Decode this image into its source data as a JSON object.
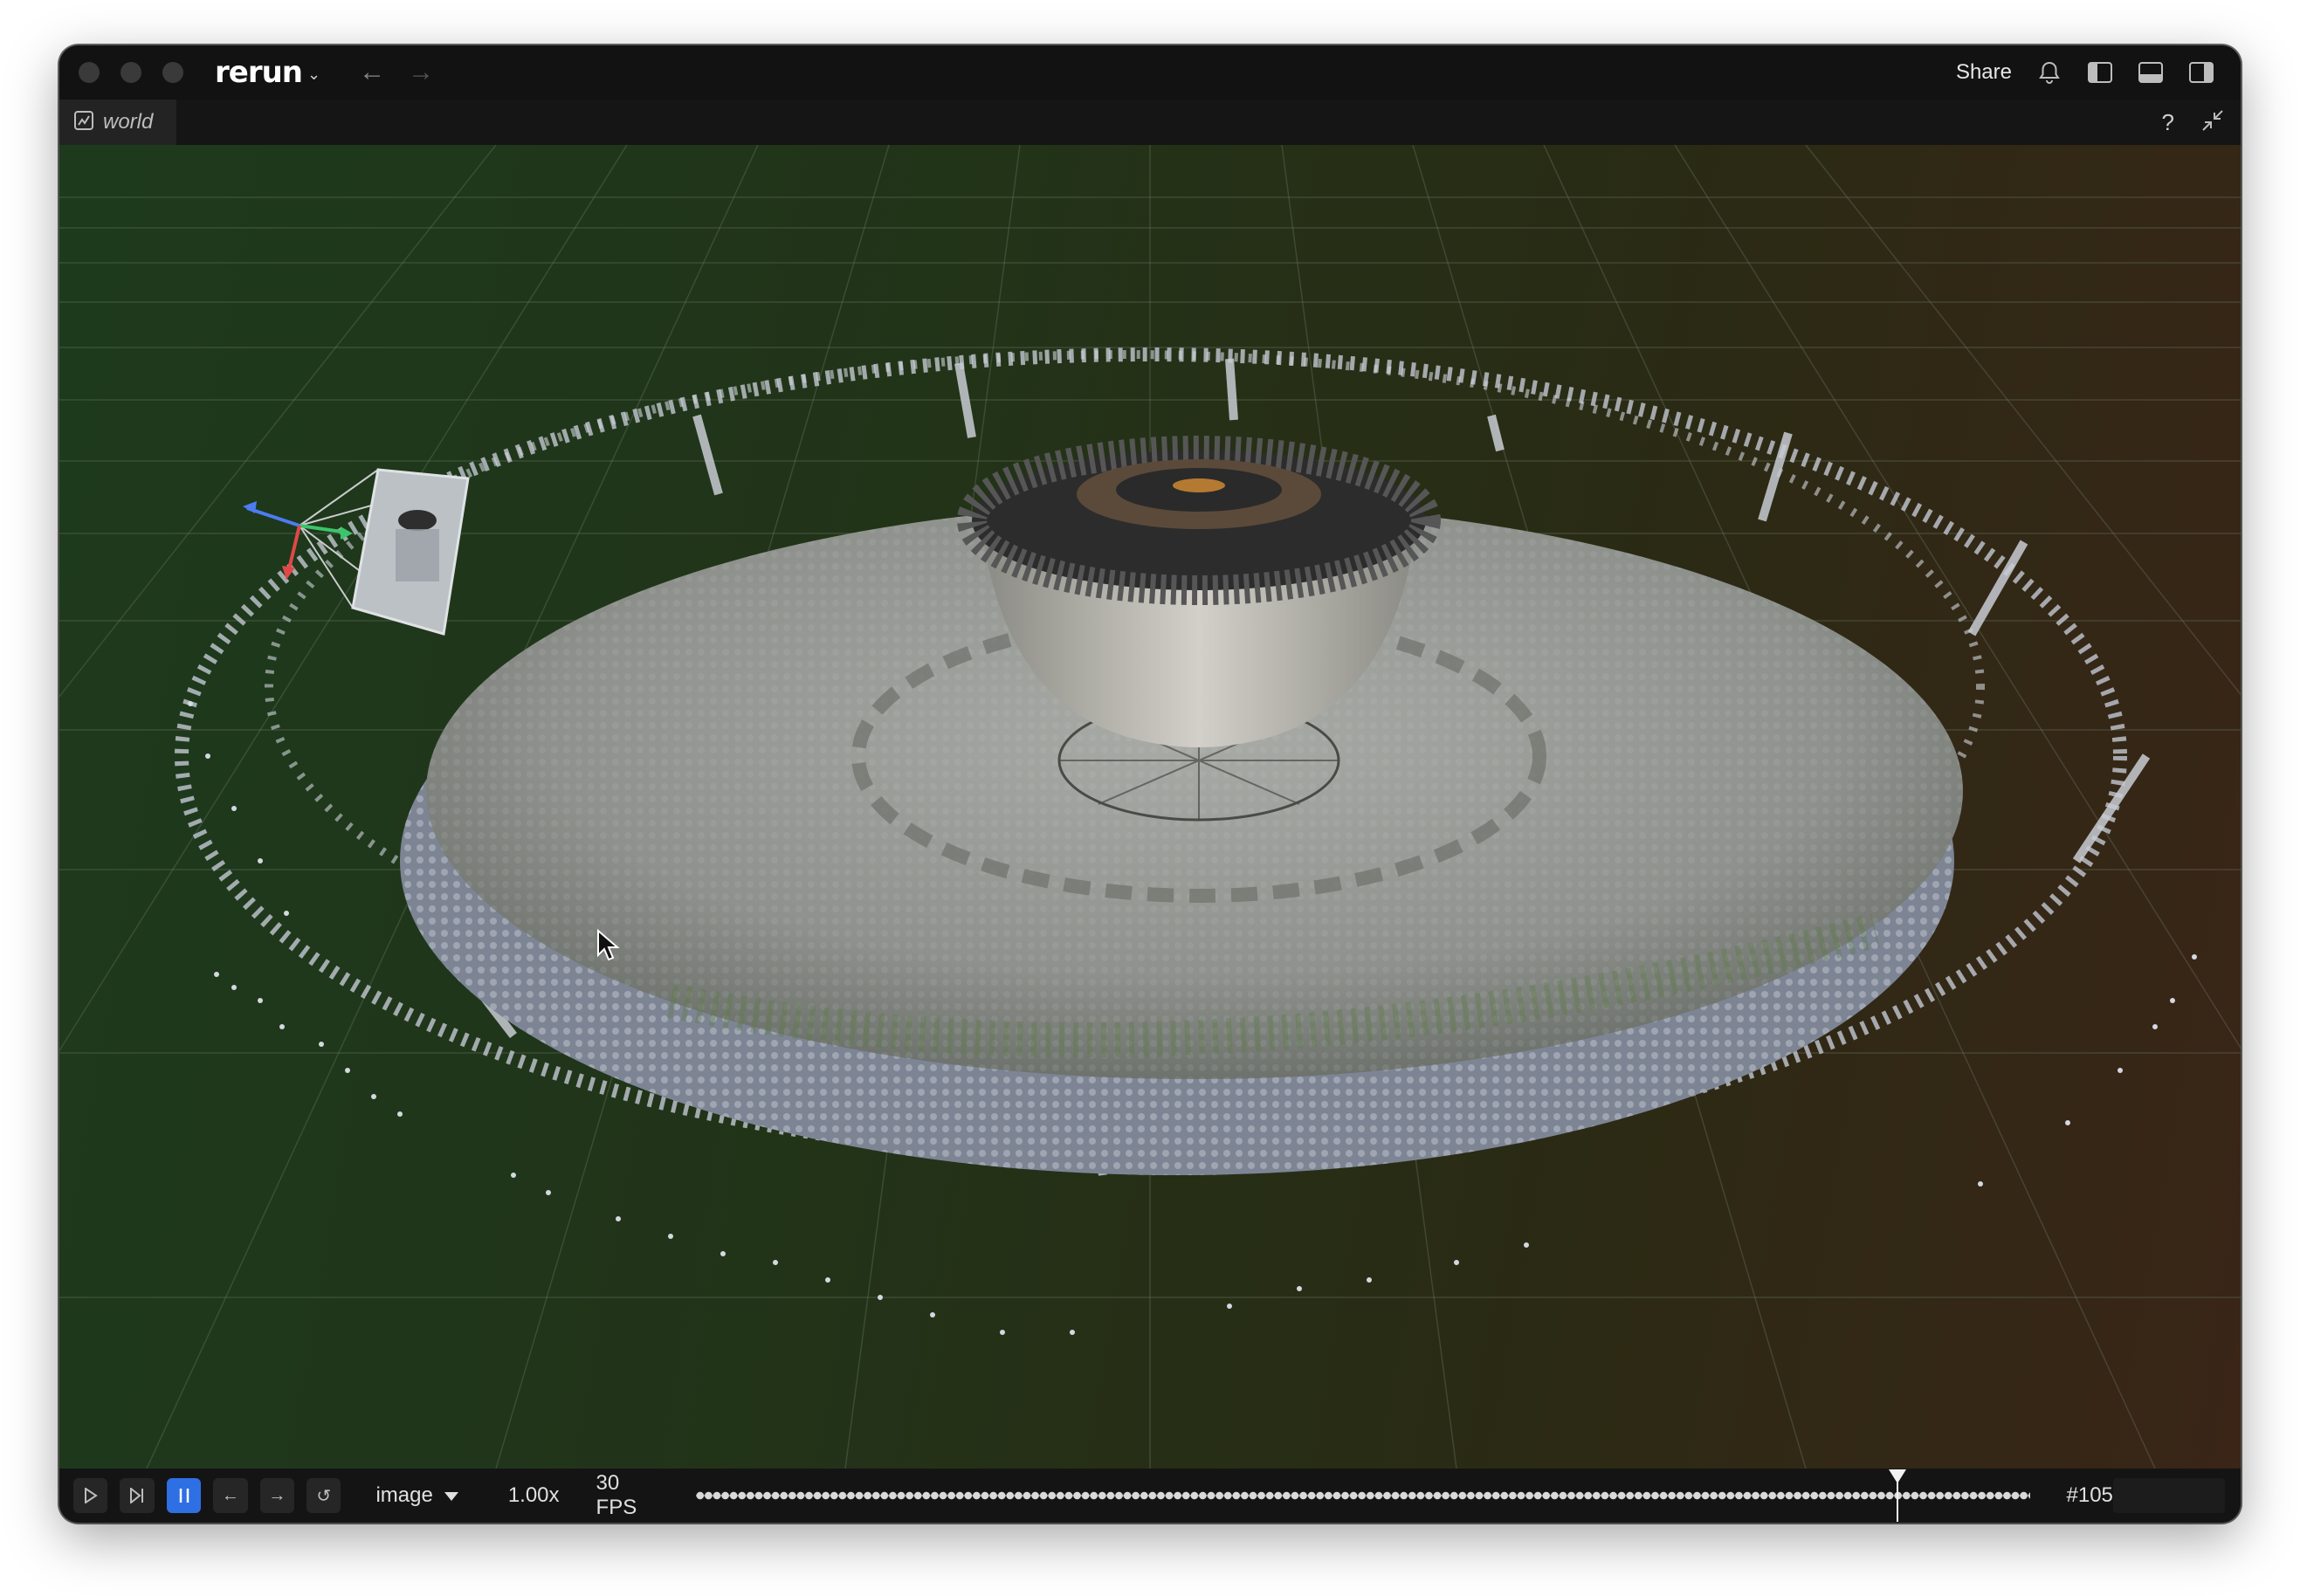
{
  "app": {
    "logo_text": "rerun",
    "share_label": "Share"
  },
  "tab": {
    "label": "world"
  },
  "toolbar": {
    "help_label": "?"
  },
  "timeline": {
    "name": "image",
    "speed": "1.00x",
    "fps": "30 FPS",
    "frame": "#105",
    "playhead_fraction": 0.9
  },
  "colors": {
    "accent": "#2f6fe4",
    "window_bg": "#121212"
  }
}
